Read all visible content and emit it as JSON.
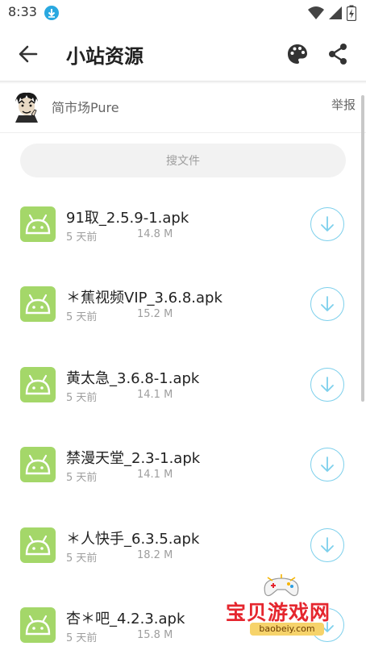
{
  "status_bar": {
    "time": "8:33",
    "download_icon": "download-notification-icon",
    "wifi_icon": "wifi-icon",
    "signal_icon": "cell-signal-icon",
    "battery_icon": "battery-charging-icon"
  },
  "app_bar": {
    "back_icon": "arrow-left-icon",
    "title": "小站资源",
    "palette_icon": "palette-icon",
    "share_icon": "share-icon"
  },
  "author": {
    "name": "简市场Pure",
    "report_label": "举报"
  },
  "search": {
    "placeholder": "搜文件"
  },
  "files": [
    {
      "name": "91取_2.5.9-1.apk",
      "date": "5 天前",
      "size": "14.8 M"
    },
    {
      "name": "＊蕉视频VIP_3.6.8.apk",
      "date": "5 天前",
      "size": "15.2 M"
    },
    {
      "name": "黄太急_3.6.8-1.apk",
      "date": "5 天前",
      "size": "14.1 M"
    },
    {
      "name": "禁漫天堂_2.3-1.apk",
      "date": "5 天前",
      "size": "14.1 M"
    },
    {
      "name": "＊人快手_6.3.5.apk",
      "date": "5 天前",
      "size": "18.2 M"
    },
    {
      "name": "杏＊吧_4.2.3.apk",
      "date": "5 天前",
      "size": "15.8 M"
    }
  ],
  "watermark": {
    "text": "宝贝游戏网",
    "url": "baobeiy.com"
  },
  "colors": {
    "accent": "#7dd0ec",
    "android_green": "#a4d769",
    "search_bg": "#f2f2f2"
  }
}
